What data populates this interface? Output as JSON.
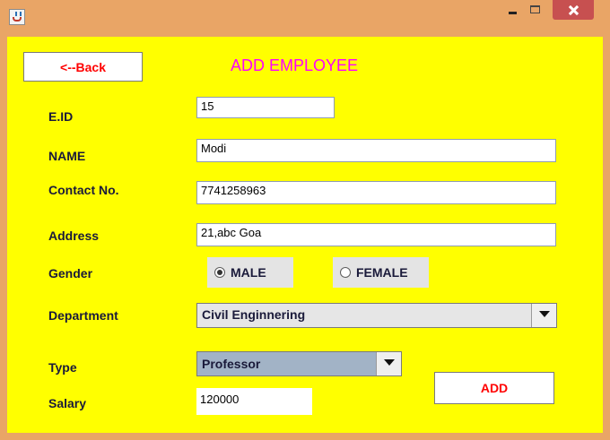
{
  "window": {
    "title": "",
    "app_icon": "java-coffee-icon",
    "controls": [
      "minimize-icon",
      "maximize-icon",
      "close-icon"
    ],
    "colors": {
      "frame": "#e9a566",
      "content_bg": "#ffff00",
      "close": "#c75050"
    }
  },
  "header": {
    "back_label": "<--Back",
    "title": "ADD EMPLOYEE",
    "title_color": "#ff00ff",
    "button_text_color": "#ff0000"
  },
  "form": {
    "eid": {
      "label": "E.ID",
      "value": "15"
    },
    "name": {
      "label": "NAME",
      "value": "Modi"
    },
    "contact": {
      "label": "Contact No.",
      "value": "7741258963"
    },
    "address": {
      "label": "Address",
      "value": "21,abc Goa"
    },
    "gender": {
      "label": "Gender",
      "options": [
        {
          "label": "MALE",
          "selected": true
        },
        {
          "label": "FEMALE",
          "selected": false
        }
      ]
    },
    "department": {
      "label": "Department",
      "selected": "Civil Enginnering"
    },
    "type": {
      "label": "Type",
      "selected": "Professor"
    },
    "salary": {
      "label": "Salary",
      "value": "120000"
    },
    "add_label": "ADD"
  }
}
